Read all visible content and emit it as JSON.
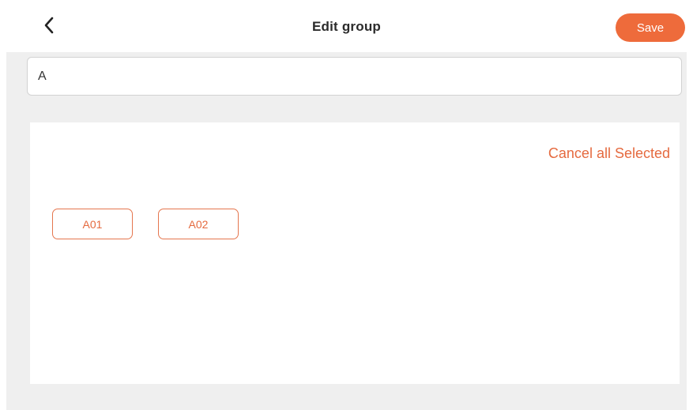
{
  "header": {
    "title": "Edit group",
    "save_label": "Save",
    "back_icon": "chevron-left-icon"
  },
  "group_name": {
    "value": "A"
  },
  "members": {
    "cancel_all_label": "Cancel all Selected",
    "items": [
      {
        "label": "A01"
      },
      {
        "label": "A02"
      }
    ]
  },
  "colors": {
    "accent": "#ee6b3b",
    "background": "#efefef",
    "panel": "#ffffff"
  }
}
